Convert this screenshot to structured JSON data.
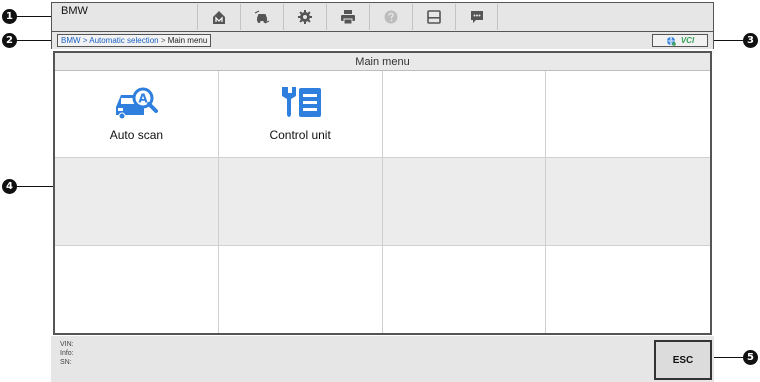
{
  "app": {
    "title": "BMW"
  },
  "toolbar": {
    "buttons": [
      {
        "icon": "home-icon"
      },
      {
        "icon": "vehicle-swap-icon"
      },
      {
        "icon": "settings-gear-icon"
      },
      {
        "icon": "printer-icon"
      },
      {
        "icon": "help-icon"
      },
      {
        "icon": "save-icon"
      },
      {
        "icon": "data-logging-icon"
      }
    ]
  },
  "breadcrumb": {
    "path_link": "BMW > Automatic selection",
    "separator": " > ",
    "current": "Main menu"
  },
  "status": {
    "vci_label": "VCI",
    "network_icon": "globe-network-icon"
  },
  "main": {
    "header": "Main menu",
    "tiles": [
      {
        "label": "Auto scan",
        "icon": "car-auto-scan-icon"
      },
      {
        "label": "Control unit",
        "icon": "control-unit-icon"
      }
    ]
  },
  "footer": {
    "vin_label": "VIN:",
    "info_label": "Info:",
    "sn_label": "SN:",
    "esc_label": "ESC"
  },
  "callouts": [
    "1",
    "2",
    "3",
    "4",
    "5"
  ],
  "colors": {
    "accent": "#2f7fde",
    "link": "#1a5fc4",
    "vci_green": "#3aa05a"
  }
}
